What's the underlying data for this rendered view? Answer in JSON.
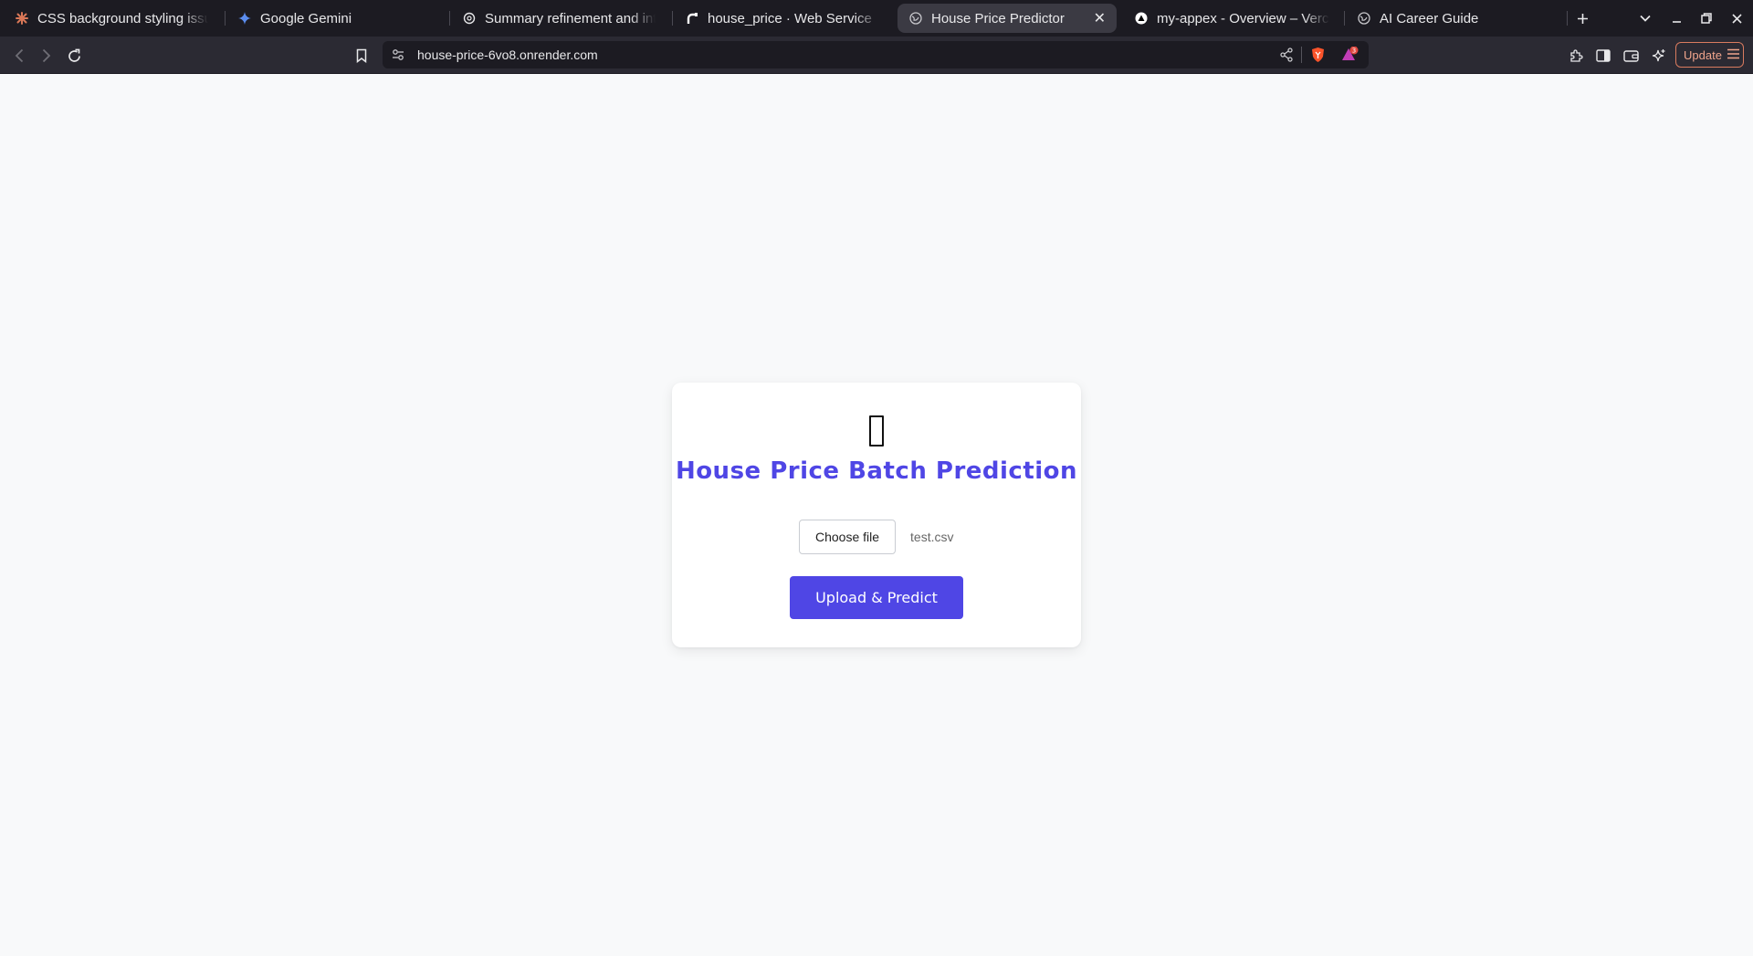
{
  "browser": {
    "tabs": [
      {
        "title": "CSS background styling issue",
        "favicon": "claude-icon"
      },
      {
        "title": "Google Gemini",
        "favicon": "gemini-icon"
      },
      {
        "title": "Summary refinement and inte",
        "favicon": "chatgpt-icon"
      },
      {
        "title": "house_price · Web Service",
        "favicon": "render-icon"
      },
      {
        "title": "House Price Predictor",
        "favicon": "globe-icon",
        "active": true
      },
      {
        "title": "my-appex - Overview – Verce",
        "favicon": "vercel-icon"
      },
      {
        "title": "AI Career Guide",
        "favicon": "globe-icon"
      }
    ],
    "url": "house-price-6vo8.onrender.com",
    "update_label": "Update",
    "notification_count": "3"
  },
  "page": {
    "title": "House Price Batch Prediction",
    "choose_file_label": "Choose file",
    "file_name": "test.csv",
    "submit_label": "Upload & Predict",
    "accent_color": "#4f46e5",
    "icon": "house-emoji-icon (missing glyph box)"
  }
}
